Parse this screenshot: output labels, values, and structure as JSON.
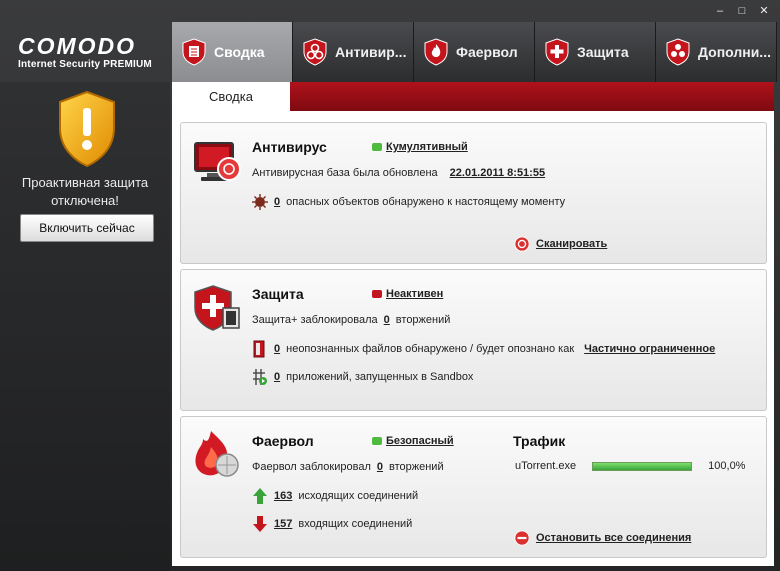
{
  "window": {
    "minimize": "–",
    "maximize": "□",
    "close": "✕"
  },
  "logo": {
    "main": "COMODO",
    "sub": "Internet Security PREMIUM"
  },
  "sidebar": {
    "message": "Проактивная защита отключена!",
    "enable_button": "Включить сейчас"
  },
  "tabs": [
    {
      "label": "Сводка",
      "icon": "summary-shield-icon",
      "active": true
    },
    {
      "label": "Антивир...",
      "icon": "biohazard-shield-icon",
      "active": false
    },
    {
      "label": "Фаервол",
      "icon": "fire-shield-icon",
      "active": false
    },
    {
      "label": "Защита",
      "icon": "cross-shield-icon",
      "active": false
    },
    {
      "label": "Дополни...",
      "icon": "more-shield-icon",
      "active": false
    }
  ],
  "subtab": {
    "label": "Сводка"
  },
  "antivirus": {
    "title": "Антивирус",
    "status": "Кумулятивный",
    "status_color": "#4dbb3c",
    "db_label": "Антивирусная база была обновлена",
    "db_date": "22.01.2011 8:51:55",
    "threats_count": "0",
    "threats_text": "опасных объектов обнаружено к настоящему моменту",
    "scan_label": "Сканировать"
  },
  "defense": {
    "title": "Защита",
    "status": "Неактивен",
    "status_color": "#c21421",
    "blocked_label": "Защита+ заблокировала",
    "blocked_count": "0",
    "blocked_suffix": "вторжений",
    "unknown_count": "0",
    "unknown_text": "неопознанных файлов обнаружено / будет опознано как",
    "unknown_link": "Частично ограниченное",
    "sandbox_count": "0",
    "sandbox_text": "приложений, запущенных в Sandbox"
  },
  "firewall": {
    "title": "Фаервол",
    "status": "Безопасный",
    "status_color": "#4dbb3c",
    "blocked_label": "Фаервол заблокировал",
    "blocked_count": "0",
    "blocked_suffix": "вторжений",
    "outgoing_count": "163",
    "outgoing_text": "исходящих соединений",
    "incoming_count": "157",
    "incoming_text": "входящих соединений",
    "stop_label": "Остановить все соединения"
  },
  "traffic": {
    "title": "Трафик",
    "items": [
      {
        "name": "uTorrent.exe",
        "percent_text": "100,0%",
        "percent": 100
      }
    ]
  }
}
